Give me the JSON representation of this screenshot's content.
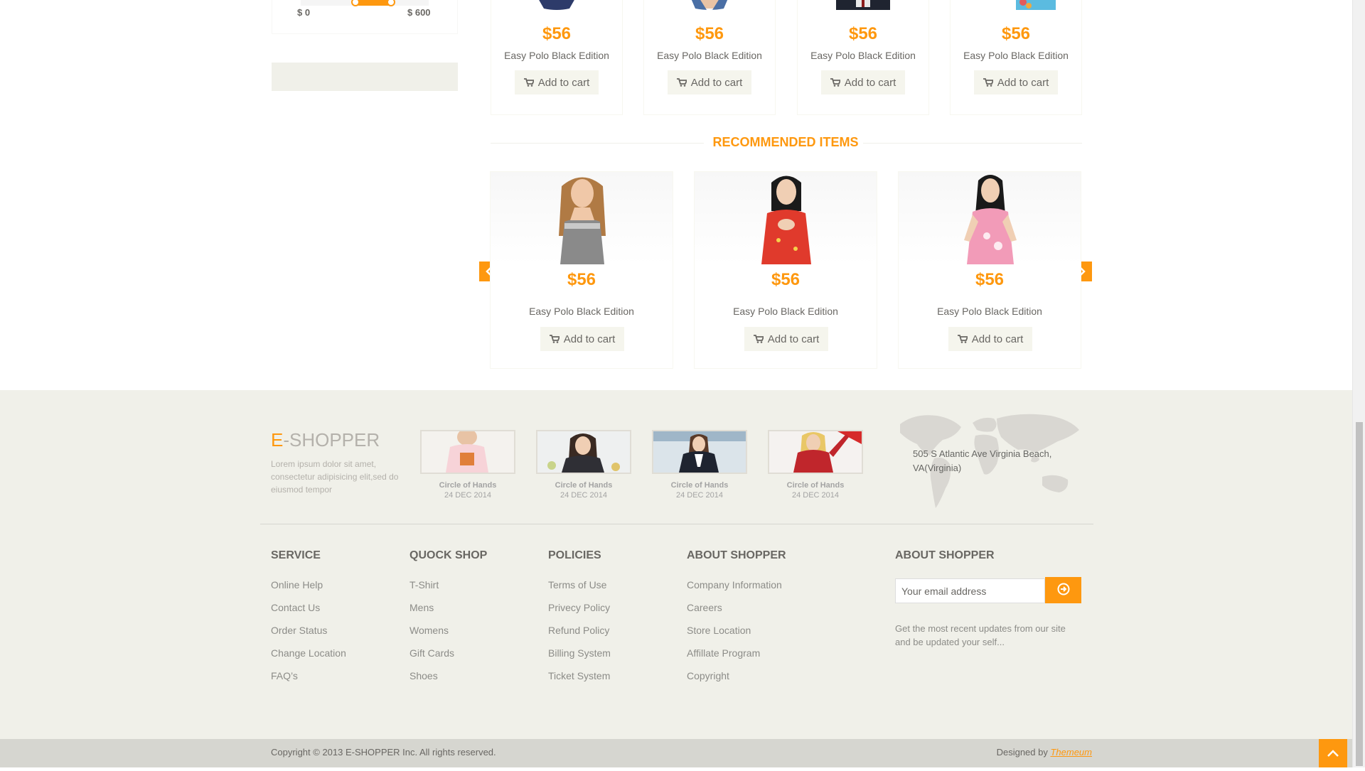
{
  "colors": {
    "accent": "#FE980F",
    "footer_bg": "#f0f0e9",
    "bottom_bar": "#d6d6d0"
  },
  "price_filter": {
    "min_label": "$ 0",
    "max_label": "$ 600"
  },
  "top_products": [
    {
      "price": "$56",
      "name": "Easy Polo Black Edition",
      "button": "Add to cart"
    },
    {
      "price": "$56",
      "name": "Easy Polo Black Edition",
      "button": "Add to cart"
    },
    {
      "price": "$56",
      "name": "Easy Polo Black Edition",
      "button": "Add to cart"
    },
    {
      "price": "$56",
      "name": "Easy Polo Black Edition",
      "button": "Add to cart"
    }
  ],
  "recommended": {
    "title": "RECOMMENDED ITEMS",
    "items": [
      {
        "price": "$56",
        "name": "Easy Polo Black Edition",
        "button": "Add to cart"
      },
      {
        "price": "$56",
        "name": "Easy Polo Black Edition",
        "button": "Add to cart"
      },
      {
        "price": "$56",
        "name": "Easy Polo Black Edition",
        "button": "Add to cart"
      }
    ],
    "prev_icon": "chevron-left-icon",
    "next_icon": "chevron-right-icon"
  },
  "footer": {
    "brand_first": "E",
    "brand_rest": "-SHOPPER",
    "brand_desc": "Lorem ipsum dolor sit amet, consectetur adipisicing elit,sed do eiusmod tempor",
    "videos": [
      {
        "title": "Circle of Hands",
        "date": "24 DEC 2014"
      },
      {
        "title": "Circle of Hands",
        "date": "24 DEC 2014"
      },
      {
        "title": "Circle of Hands",
        "date": "24 DEC 2014"
      },
      {
        "title": "Circle of Hands",
        "date": "24 DEC 2014"
      }
    ],
    "address": "505 S Atlantic Ave Virginia Beach, VA(Virginia)",
    "service": {
      "title": "SERVICE",
      "items": [
        "Online Help",
        "Contact Us",
        "Order Status",
        "Change Location",
        "FAQ’s"
      ]
    },
    "quick_shop": {
      "title": "QUOCK SHOP",
      "items": [
        "T-Shirt",
        "Mens",
        "Womens",
        "Gift Cards",
        "Shoes"
      ]
    },
    "policies": {
      "title": "POLICIES",
      "items": [
        "Terms of Use",
        "Privecy Policy",
        "Refund Policy",
        "Billing System",
        "Ticket System"
      ]
    },
    "about": {
      "title": "ABOUT SHOPPER",
      "items": [
        "Company Information",
        "Careers",
        "Store Location",
        "Affillate Program",
        "Copyright"
      ]
    },
    "newsletter": {
      "title": "ABOUT SHOPPER",
      "placeholder": "Your email address",
      "desc": "Get the most recent updates from our site and be updated your self..."
    },
    "copyright": "Copyright © 2013 E-SHOPPER Inc. All rights reserved.",
    "designed_prefix": "Designed by ",
    "designed_link": "Themeum"
  }
}
